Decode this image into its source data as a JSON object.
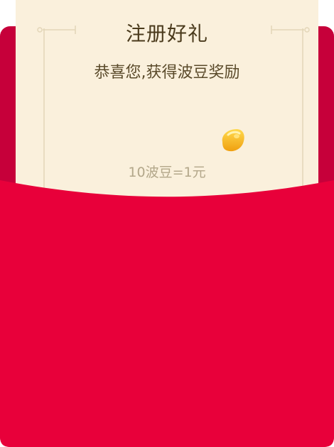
{
  "letter": {
    "title": "注册好礼",
    "subtitle": "恭喜您,获得波豆奖励",
    "exchange_rate": "10波豆=1元"
  },
  "icons": {
    "bean": "bean-icon"
  },
  "colors": {
    "envelope_back": "#c6003a",
    "envelope_front": "#e8003a",
    "letter_bg": "#faf0dc",
    "bean_gold": "#f7b51c"
  }
}
